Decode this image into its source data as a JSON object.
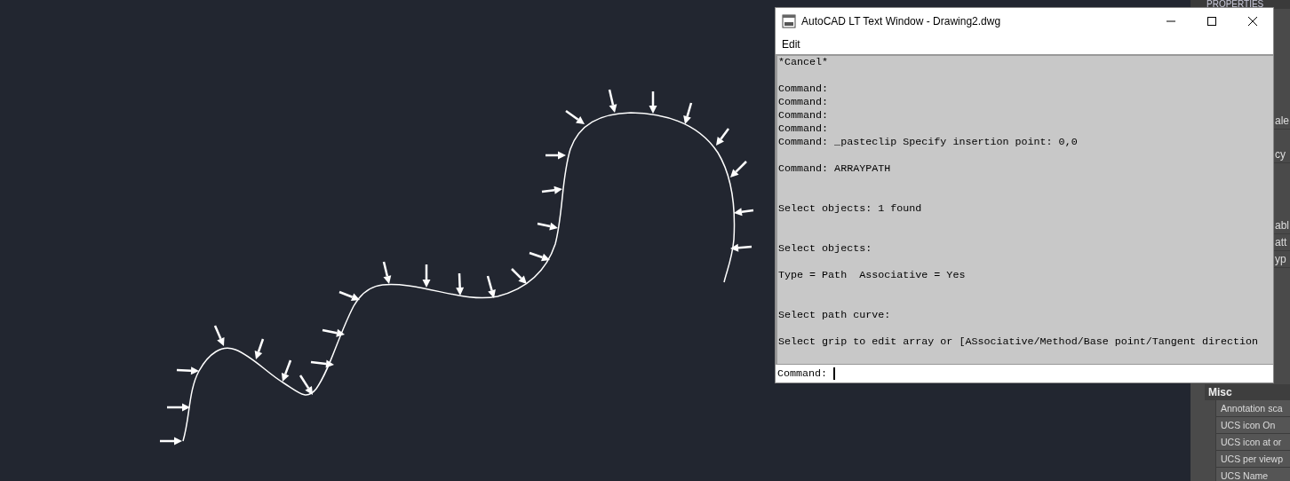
{
  "properties_panel": {
    "title": "PROPERTIES",
    "groups": [
      {
        "rows": [
          "ale",
          "cy"
        ]
      },
      {
        "rows": [
          "abl",
          "att",
          "yp"
        ]
      },
      {
        "header": "Misc",
        "rows": [
          "Annotation sca",
          "UCS icon On",
          "UCS icon at or",
          "UCS per viewp",
          "UCS Name"
        ]
      }
    ]
  },
  "text_window": {
    "title": "AutoCAD LT Text Window - Drawing2.dwg",
    "menu": [
      "Edit"
    ],
    "lines": [
      {
        "kind": "text",
        "text": "*Cancel*"
      },
      {
        "kind": "blank"
      },
      {
        "kind": "text",
        "text": "Command:"
      },
      {
        "kind": "text",
        "text": "Command:"
      },
      {
        "kind": "text",
        "text": "Command:"
      },
      {
        "kind": "text",
        "text": "Command:"
      },
      {
        "kind": "text",
        "text": "Command: _pasteclip Specify insertion point: 0,0"
      },
      {
        "kind": "blank"
      },
      {
        "kind": "text",
        "text": "Command: ARRAYPATH"
      },
      {
        "kind": "blank"
      },
      {
        "kind": "blank"
      },
      {
        "kind": "text",
        "text": "Select objects: 1 found"
      },
      {
        "kind": "blank"
      },
      {
        "kind": "blank"
      },
      {
        "kind": "text",
        "text": "Select objects:"
      },
      {
        "kind": "blank"
      },
      {
        "kind": "text",
        "text": "Type = Path  Associative = Yes"
      },
      {
        "kind": "blank"
      },
      {
        "kind": "blank"
      },
      {
        "kind": "text",
        "text": "Select path curve:"
      },
      {
        "kind": "blank"
      },
      {
        "kind": "text",
        "text": "Select grip to edit array or [ASsociative/Method/Base point/Tangent direction"
      }
    ],
    "prompt": "Command:"
  }
}
